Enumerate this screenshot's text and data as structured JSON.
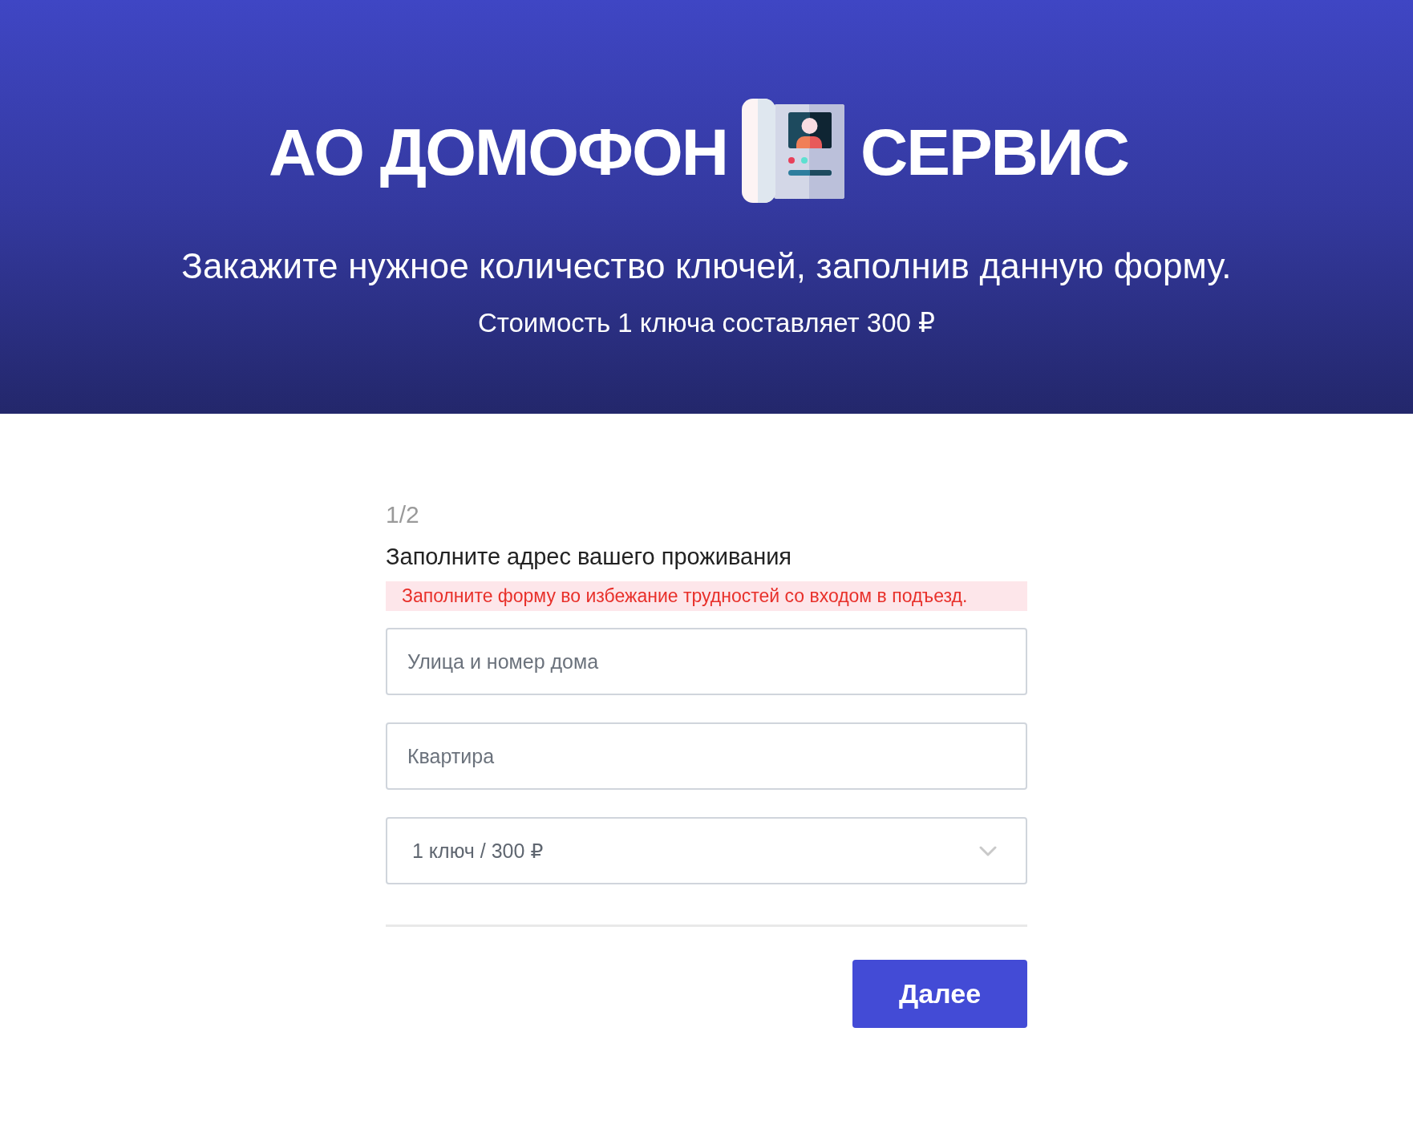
{
  "header": {
    "logo": {
      "left_text": "АО ДОМОФОН",
      "right_text": "СЕРВИС"
    },
    "headline": "Закажите нужное количество ключей, заполнив данную форму.",
    "price_note": "Стоимость 1 ключа составляет 300 ₽"
  },
  "form": {
    "step": "1/2",
    "title": "Заполните адрес вашего проживания",
    "alert": "Заполните форму во избежание трудностей со входом в подъезд.",
    "fields": [
      {
        "kind": "text",
        "placeholder": "Улица и номер дома"
      },
      {
        "kind": "text",
        "placeholder": "Квартира"
      },
      {
        "kind": "select",
        "value": "1 ключ / 300 ₽"
      }
    ],
    "next_button": "Далее"
  }
}
